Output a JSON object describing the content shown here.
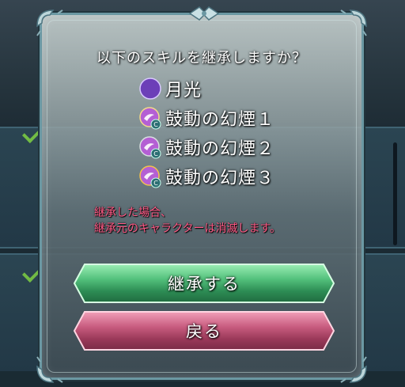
{
  "dialog": {
    "question": "以下のスキルを継承しますか？",
    "skills": [
      {
        "name": "月光",
        "icon": "moonlight-skill-icon",
        "color": "#8f5bd8"
      },
      {
        "name": "鼓動の幻煙１",
        "icon": "heartbeat-smoke-skill-icon",
        "color": "#c86de0"
      },
      {
        "name": "鼓動の幻煙２",
        "icon": "heartbeat-smoke-skill-icon",
        "color": "#c86de0"
      },
      {
        "name": "鼓動の幻煙３",
        "icon": "heartbeat-smoke-skill-icon",
        "color": "#c86de0"
      }
    ],
    "warning_line1": "継承した場合、",
    "warning_line2": "継承元のキャラクターは消滅します。",
    "buttons": {
      "inherit_label": "継承する",
      "back_label": "戻る"
    }
  },
  "colors": {
    "warning": "#ff5a86",
    "inherit_button": "#52c07b",
    "back_button": "#c85c7f",
    "frame": "#6b98a3"
  }
}
